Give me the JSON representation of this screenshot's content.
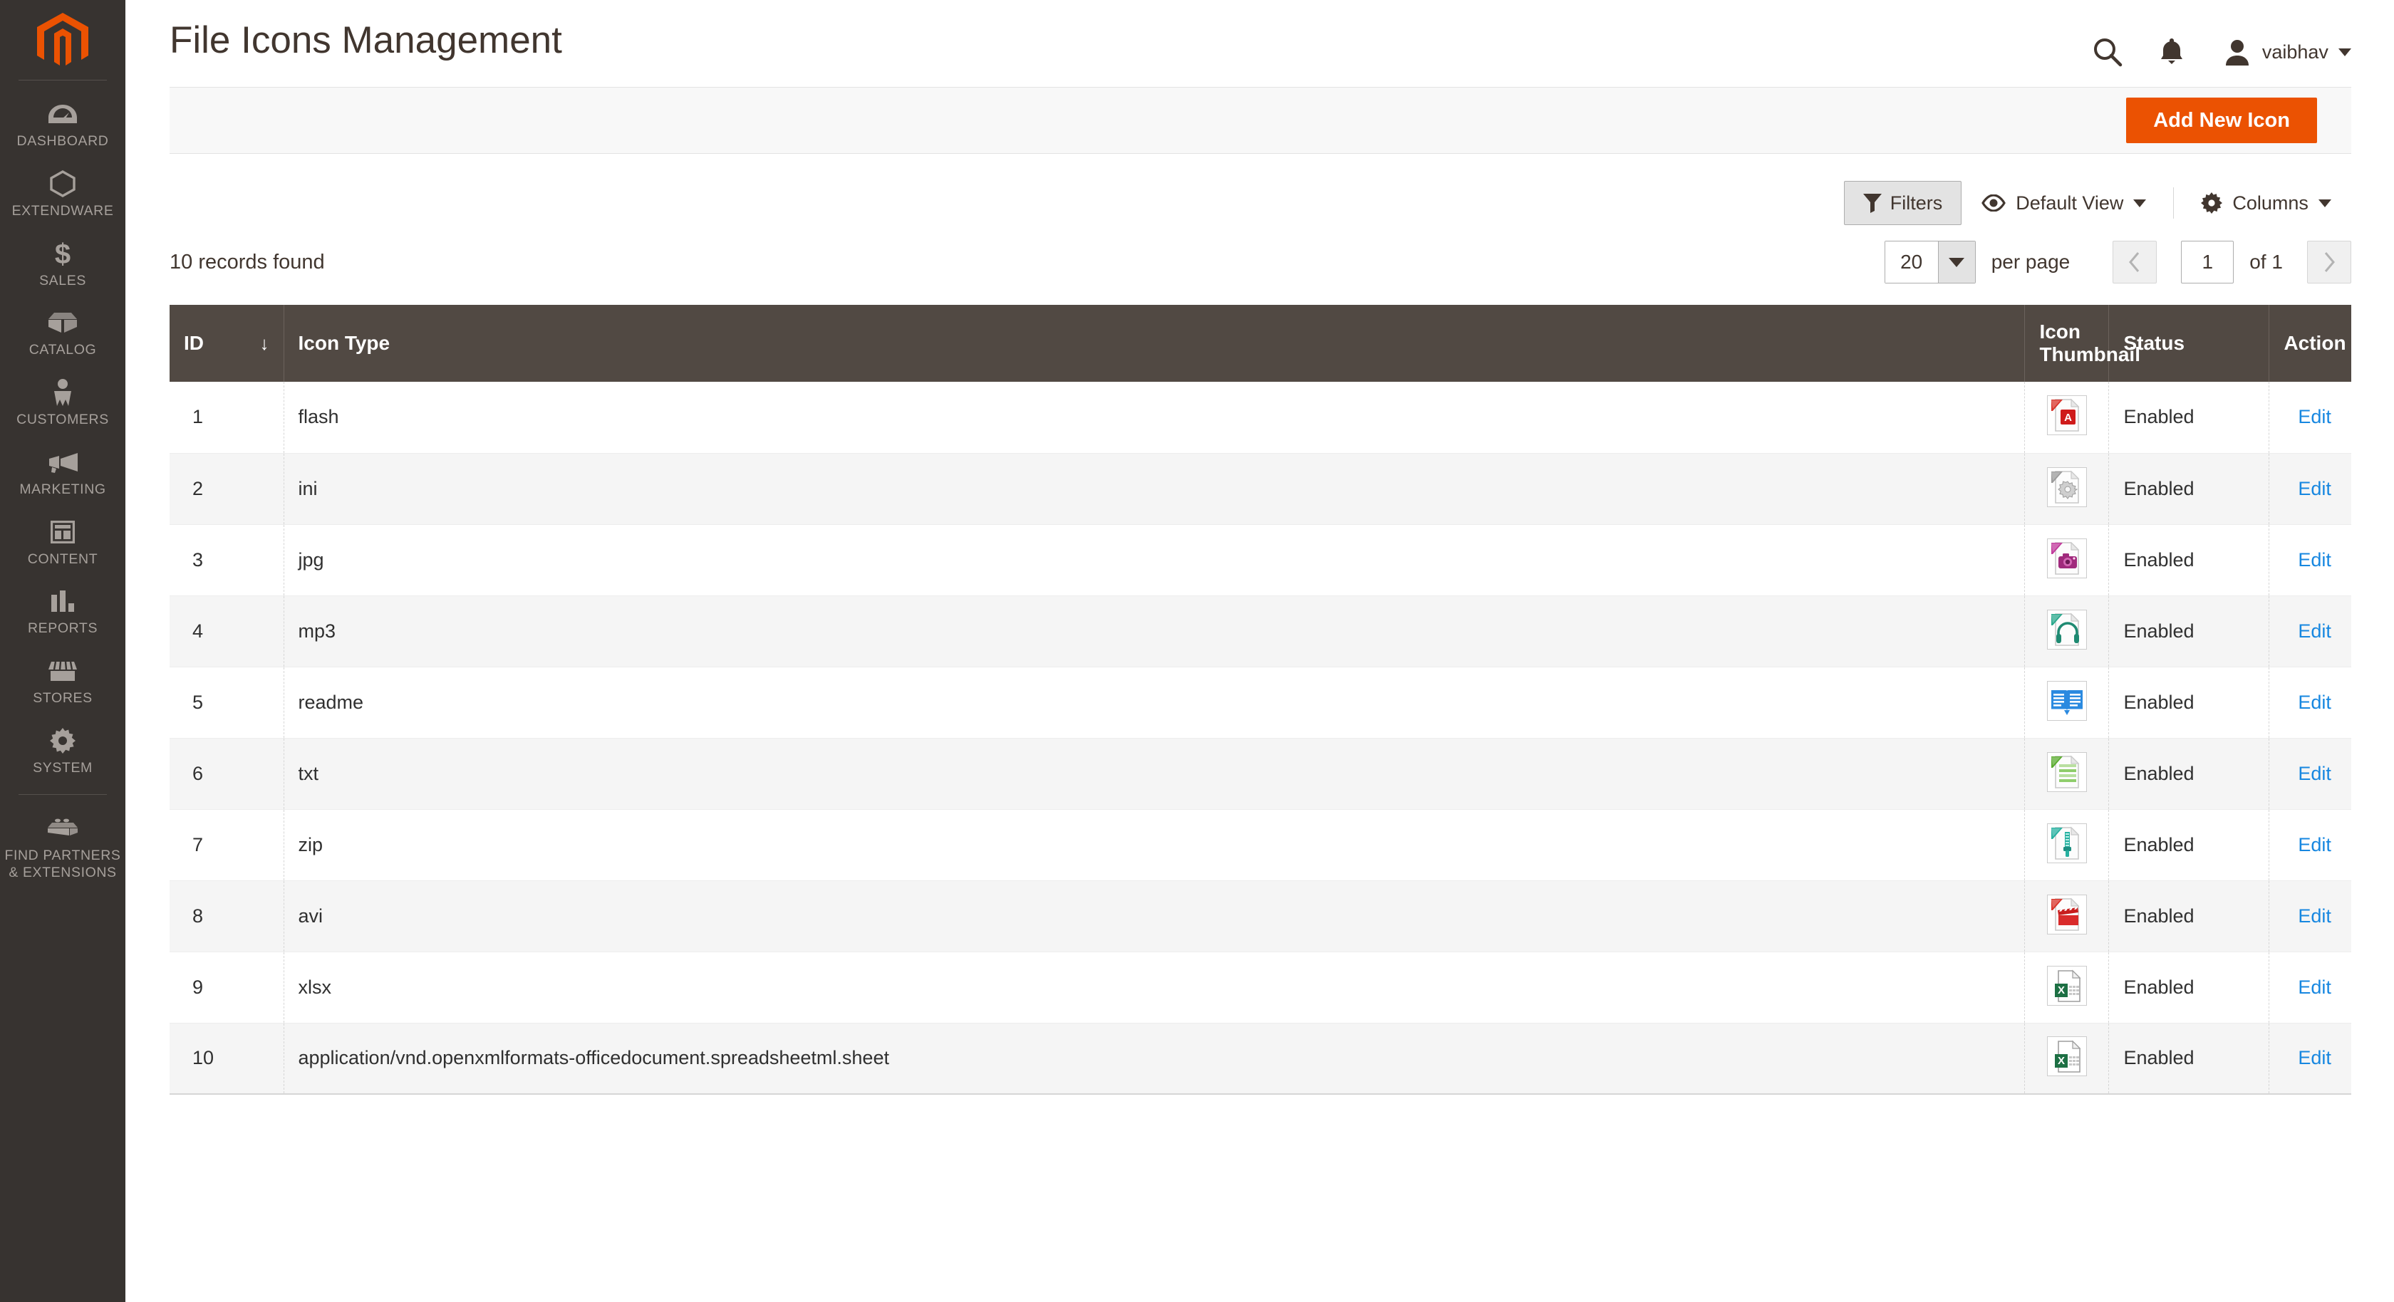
{
  "sidebar": {
    "logo_icon": "magento-logo-icon",
    "brand_color": "#eb5202",
    "background": "#373330",
    "items": [
      {
        "label": "DASHBOARD",
        "icon": "dashboard-gauge-icon"
      },
      {
        "label": "EXTENDWARE",
        "icon": "hexagon-outline-icon"
      },
      {
        "label": "SALES",
        "icon": "dollar-sign-icon"
      },
      {
        "label": "CATALOG",
        "icon": "box-icon"
      },
      {
        "label": "CUSTOMERS",
        "icon": "person-icon"
      },
      {
        "label": "MARKETING",
        "icon": "megaphone-icon"
      },
      {
        "label": "CONTENT",
        "icon": "layout-page-icon"
      },
      {
        "label": "REPORTS",
        "icon": "bar-chart-icon"
      },
      {
        "label": "STORES",
        "icon": "storefront-icon"
      },
      {
        "label": "SYSTEM",
        "icon": "gear-icon"
      },
      {
        "label": "FIND PARTNERS\n& EXTENSIONS",
        "icon": "lego-brick-icon"
      }
    ]
  },
  "header": {
    "title": "File Icons Management",
    "search_icon": "search-icon",
    "notifications_icon": "bell-icon",
    "avatar_icon": "user-avatar-icon",
    "username": "vaibhav",
    "user_caret_icon": "chevron-down-icon"
  },
  "page_actions": {
    "add_new_label": "Add New Icon",
    "accent_color": "#eb5202"
  },
  "toolbar": {
    "filters_label": "Filters",
    "filters_icon": "funnel-icon",
    "view_icon": "eye-icon",
    "view_label": "Default View",
    "view_caret_icon": "chevron-down-icon",
    "columns_icon": "gear-icon",
    "columns_label": "Columns",
    "columns_caret_icon": "chevron-down-icon"
  },
  "grid_meta": {
    "records_found": "10 records found",
    "per_page_value": "20",
    "per_page_label": "per page",
    "per_page_caret_icon": "caret-down-icon",
    "prev_icon": "chevron-left-icon",
    "next_icon": "chevron-right-icon",
    "current_page": "1",
    "of_label": "of 1"
  },
  "table": {
    "columns": {
      "id": "ID",
      "icon_type": "Icon Type",
      "icon_thumbnail": "Icon Thumbnail",
      "status": "Status",
      "action": "Action"
    },
    "sort": {
      "column": "ID",
      "direction": "desc",
      "arrow_glyph": "↓"
    },
    "rows": [
      {
        "id": "1",
        "icon_type": "flash",
        "thumbnail_icon": "flash-file-icon",
        "status": "Enabled",
        "action": "Edit"
      },
      {
        "id": "2",
        "icon_type": "ini",
        "thumbnail_icon": "ini-gear-file-icon",
        "status": "Enabled",
        "action": "Edit"
      },
      {
        "id": "3",
        "icon_type": "jpg",
        "thumbnail_icon": "jpg-camera-file-icon",
        "status": "Enabled",
        "action": "Edit"
      },
      {
        "id": "4",
        "icon_type": "mp3",
        "thumbnail_icon": "mp3-headphones-file-icon",
        "status": "Enabled",
        "action": "Edit"
      },
      {
        "id": "5",
        "icon_type": "readme",
        "thumbnail_icon": "readme-book-icon",
        "status": "Enabled",
        "action": "Edit"
      },
      {
        "id": "6",
        "icon_type": "txt",
        "thumbnail_icon": "txt-lines-file-icon",
        "status": "Enabled",
        "action": "Edit"
      },
      {
        "id": "7",
        "icon_type": "zip",
        "thumbnail_icon": "zip-zipper-file-icon",
        "status": "Enabled",
        "action": "Edit"
      },
      {
        "id": "8",
        "icon_type": "avi",
        "thumbnail_icon": "avi-clapperboard-file-icon",
        "status": "Enabled",
        "action": "Edit"
      },
      {
        "id": "9",
        "icon_type": "xlsx",
        "thumbnail_icon": "xlsx-excel-file-icon",
        "status": "Enabled",
        "action": "Edit"
      },
      {
        "id": "10",
        "icon_type": "application/vnd.openxmlformats-officedocument.spreadsheetml.sheet",
        "thumbnail_icon": "xlsx-excel-file-icon",
        "status": "Enabled",
        "action": "Edit"
      }
    ]
  },
  "colors": {
    "header_row": "#514943",
    "link": "#1787e0",
    "text": "#41362f",
    "row_alt": "#f5f5f5"
  }
}
